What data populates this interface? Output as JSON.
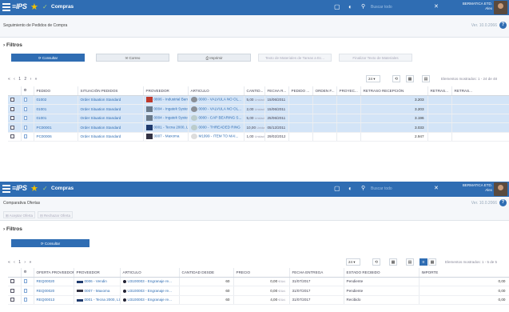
{
  "colors": {
    "brand": "#2f6db3",
    "selected_row": "#d3e4f7",
    "star": "#f2c200"
  },
  "p1": {
    "topbar": {
      "logo": "≡IPS",
      "title": "Compras",
      "search_placeholder": "Buscar todo",
      "user_line1": "BERMATICA ETD.",
      "user_line2": "Alex"
    },
    "breadcrumb": "Seguimiento de Pedidos de Compra",
    "version": "Ver. 10.0.2066",
    "filters_label": "Filtros",
    "buttons": {
      "consultar": "Consultar",
      "correo": "Correo",
      "imprimir": "Imprimir",
      "texto_materiales_tareas": "Texto de Materiales de Tareas a Ec...",
      "finalizar_texto": "Finalizar Texto de Materiales"
    },
    "pager": {
      "nav": "« ‹ 1 2 › »",
      "per_page": "24",
      "shown": "Elementos mostrados: 1 - 24 de 48"
    },
    "columns": [
      "",
      "",
      "PEDIDO",
      "SITUACIÓN PEDIDOS",
      "PROVEEDOR",
      "ARTICULO",
      "CANTID...",
      "FECHA R...",
      "PEDIDO ...",
      "ORDEN F...",
      "PROYEC...",
      "RETRASO RECEPCIÓN",
      "RETRAS...",
      "RETRAS..."
    ],
    "rows": [
      {
        "pedido": "01002",
        "situacion": "Order Situation Standard",
        "proveedor": "0806 - Industrial Barca...",
        "articulo": "0000 - VALVULA NO OL...",
        "cantidad": "5,00",
        "unidad": "Unidad",
        "fecha": "15/06/2011",
        "retraso": "3.203"
      },
      {
        "pedido": "01001",
        "situacion": "Order Situation Standard",
        "proveedor": "0004 - Ingatek Systems...",
        "articulo": "0000 - VALVULA NO OL...",
        "cantidad": "2,00",
        "unidad": "Unidad",
        "fecha": "15/06/2011",
        "retraso": "3.203"
      },
      {
        "pedido": "01001",
        "situacion": "Order Situation Standard",
        "proveedor": "0004 - Ingatek Systems...",
        "articulo": "0000 - CAP BEARING S...",
        "cantidad": "5,00",
        "unidad": "Unidad",
        "fecha": "25/06/2011",
        "retraso": "3.196"
      },
      {
        "pedido": "PC00001",
        "situacion": "Order Situation Standard",
        "proveedor": "0001 - Tecna 2000, Ltd.",
        "articulo": "0000 - THREADED RING",
        "cantidad": "10,00",
        "unidad": "Unidad",
        "fecha": "05/12/2011",
        "retraso": "3.033"
      },
      {
        "pedido": "PC00006",
        "situacion": "Order Situation Standard",
        "proveedor": "0007 - Maxoma",
        "articulo": "M1999 - ITEM TO MAI...",
        "cantidad": "1,00",
        "unidad": "Unidad",
        "fecha": "29/02/2012",
        "retraso": "2.947"
      }
    ]
  },
  "p2": {
    "topbar": {
      "logo": "≡IPS",
      "title": "Compras",
      "search_placeholder": "Buscar todo",
      "user_line1": "BERMATICA ETD.",
      "user_line2": "Alex"
    },
    "breadcrumb": "Comparativa Ofertas",
    "version": "Ver. 10.0.2066",
    "actions": {
      "aceptar": "Aceptar Oferta",
      "rechazar": "Rechazar Oferta"
    },
    "filters_label": "Filtros",
    "consultar": "Consultar",
    "pager": {
      "nav": "« ‹ 1 › »",
      "per_page": "24",
      "shown": "Elementos mostrados: 1 - 5 de 5"
    },
    "columns": [
      "",
      "",
      "OFERTA PROVEEDOR",
      "PROVEEDOR",
      "ARTICULO",
      "CANTIDAD DESDE",
      "PRECIO",
      "FECHA ENTREGA",
      "ESTADO RECIBIDO",
      "IMPORTE"
    ],
    "rows": [
      {
        "oferta": "REQ00020",
        "proveedor": "0006 - Vendin",
        "articulo": "U3100003 - Engranaje re...",
        "cantidad": "60",
        "precio": "0,00",
        "moneda": "€/Ud.",
        "fecha": "31/07/2017",
        "estado": "Pendiente",
        "importe": "0,00"
      },
      {
        "oferta": "REQ00020",
        "proveedor": "0007 - Maxoma",
        "articulo": "U3100003 - Engranaje re...",
        "cantidad": "60",
        "precio": "0,00",
        "moneda": "€/Ud.",
        "fecha": "31/07/2017",
        "estado": "Pendiente",
        "importe": "0,00"
      },
      {
        "oferta": "REQ00013",
        "proveedor": "0001 - Tecna 2000, Ltd.",
        "articulo": "U3100003 - Engranaje re...",
        "cantidad": "60",
        "precio": "4,00",
        "moneda": "€/Ud.",
        "fecha": "31/07/2017",
        "estado": "Recibido",
        "importe": "0,00"
      }
    ]
  }
}
